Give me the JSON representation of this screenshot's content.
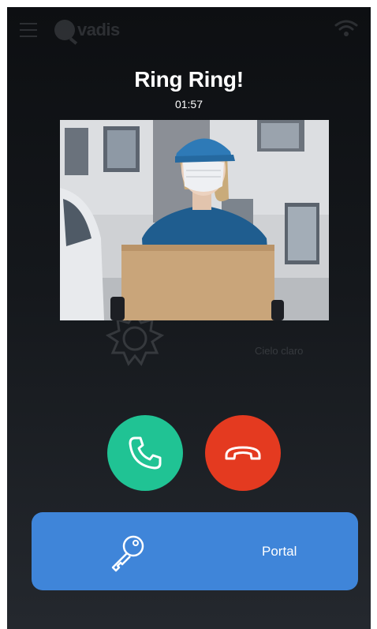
{
  "app": {
    "logo_text": "vadis",
    "weather_text": "Cielo claro"
  },
  "call": {
    "title": "Ring Ring!",
    "timer": "01:57"
  },
  "actions": {
    "portal_label": "Portal"
  },
  "colors": {
    "accept": "#20c394",
    "decline": "#e43a20",
    "portal": "#3f85d9"
  },
  "icons": {
    "menu": "menu-icon",
    "wifi": "wifi-icon",
    "accept": "phone-icon",
    "decline": "hang-up-icon",
    "portal": "key-icon",
    "weather": "sun-icon"
  }
}
